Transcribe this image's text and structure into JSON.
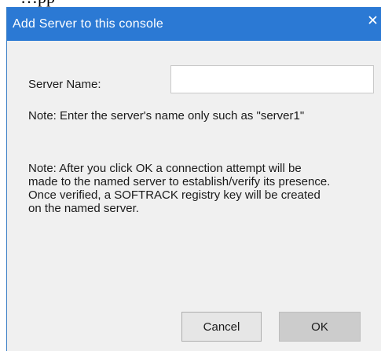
{
  "background_text": "…pp",
  "dialog": {
    "title": "Add Server to this console",
    "close_label": "Close",
    "server_name_label": "Server Name:",
    "server_name_value": "",
    "server_name_placeholder": "",
    "note_short": "Note: Enter the server's name only such as \"server1\"",
    "note_long_lines": [
      "Note: After you click OK a connection attempt will be",
      "made to the named server to establish/verify its presence.",
      "Once verified, a SOFTRACK registry key will be created",
      "on the named server."
    ],
    "cancel_label": "Cancel",
    "ok_label": "OK"
  },
  "colors": {
    "titlebar": "#2b79d4",
    "title_text": "#ffffff",
    "dialog_body": "#f0f0f0",
    "ok_button_bg": "#cccccc",
    "cancel_button_bg": "#e6e6e6"
  }
}
